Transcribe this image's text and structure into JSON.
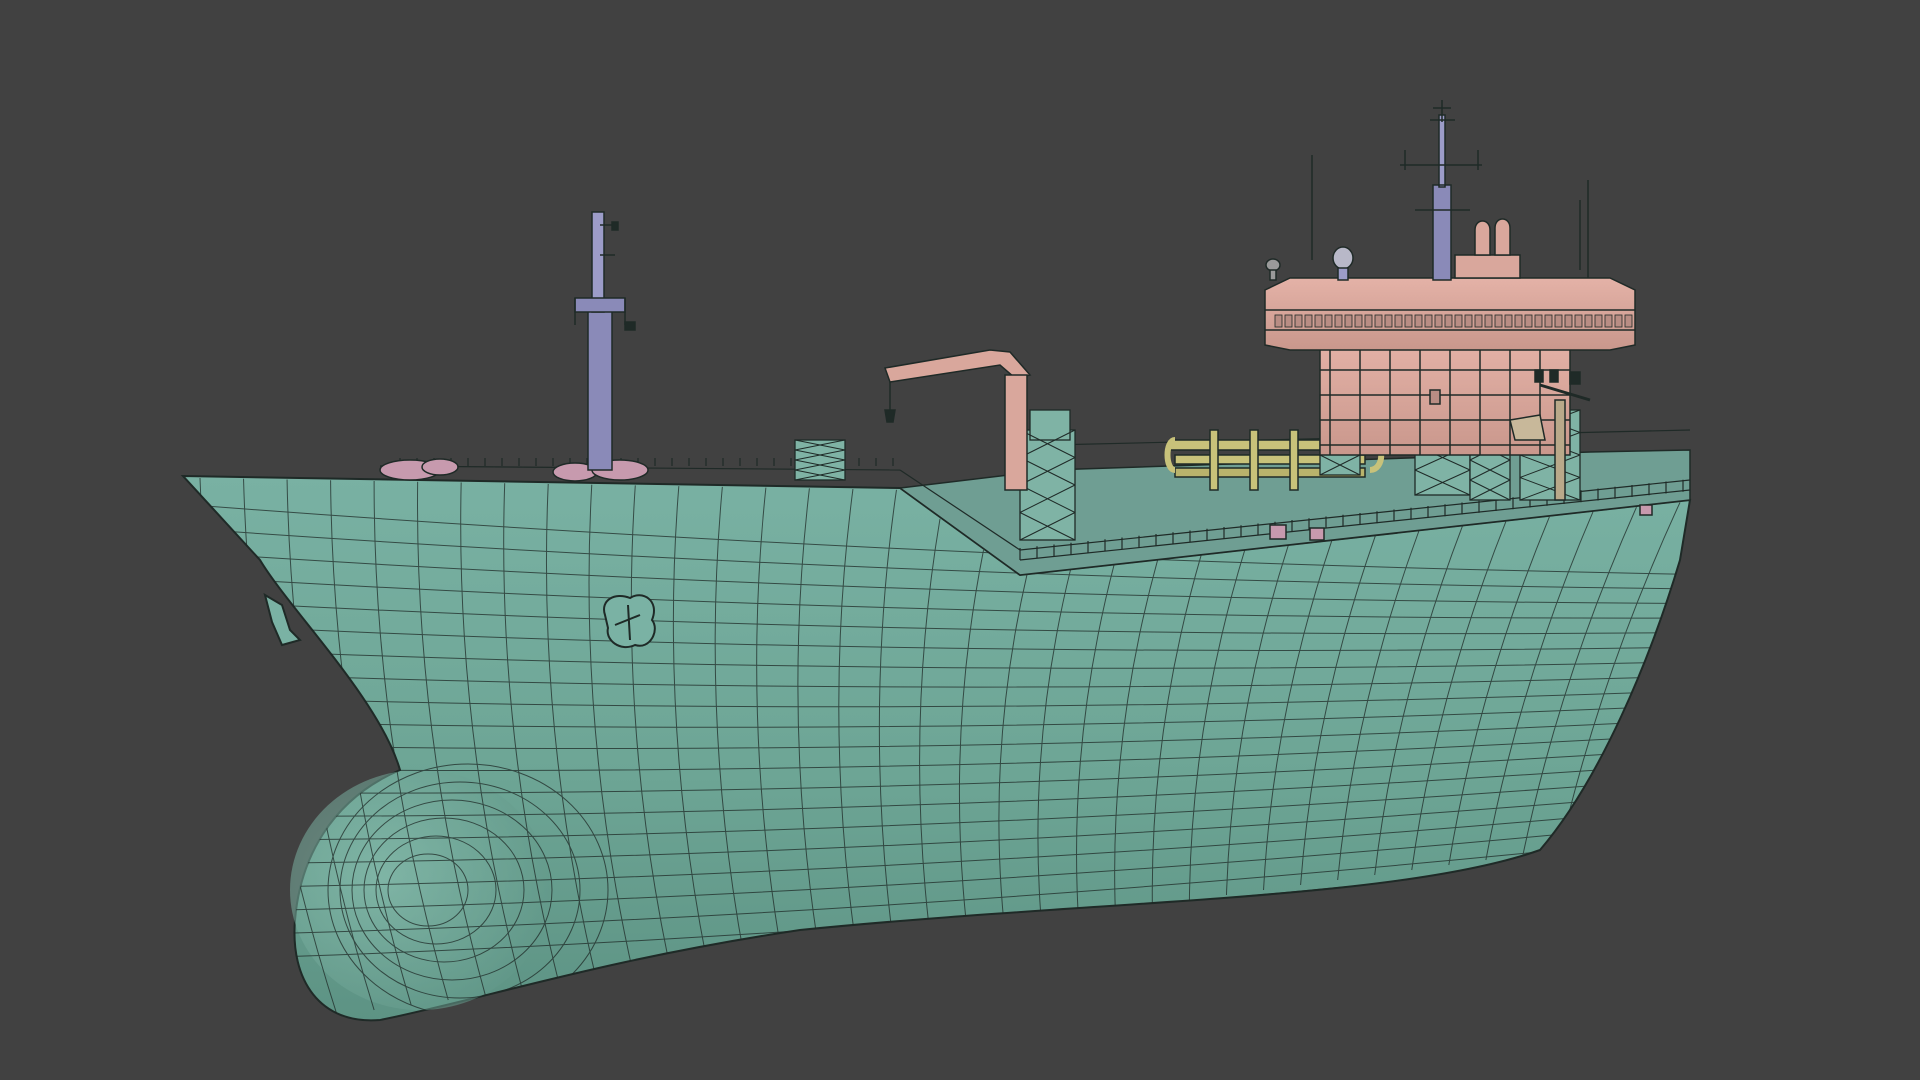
{
  "viewport": {
    "background": "#414141",
    "mode": "wireframe-on-shaded"
  },
  "model": {
    "name": "oil tanker",
    "colors": {
      "hull": "#6ea89a",
      "hull_light": "#84bcae",
      "hull_dark": "#4f8677",
      "deck": "#7fb3a5",
      "superstructure": "#d9a79c",
      "superstructure_dark": "#b98d84",
      "mast": "#8a8ab8",
      "pipes": "#c8c27a",
      "mooring": "#c79aae",
      "wire": "#1f2a27"
    }
  }
}
